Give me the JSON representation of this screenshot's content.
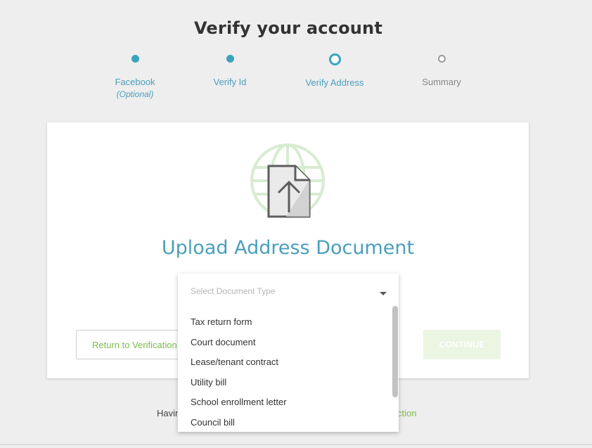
{
  "page": {
    "title": "Verify your account"
  },
  "steps": [
    {
      "label": "Facebook",
      "sublabel": "(Optional)",
      "state": "done"
    },
    {
      "label": "Verify Id",
      "state": "done"
    },
    {
      "label": "Verify Address",
      "state": "current"
    },
    {
      "label": "Summary",
      "state": "future"
    }
  ],
  "card": {
    "heading": "Upload Address Document",
    "return_label": "Return to Verification",
    "continue_label": "CONTINUE"
  },
  "dropdown": {
    "placeholder": "Select Document Type",
    "options": [
      "Tax return form",
      "Court document",
      "Lease/tenant contract",
      "Utility bill",
      "School enrollment letter",
      "Council bill"
    ]
  },
  "footer": {
    "help_text": "Havin",
    "help_link": "ction"
  },
  "colors": {
    "accent_blue": "#3aa4bf",
    "accent_green": "#7dbb4a",
    "continue_disabled_bg": "#eaf5e2"
  }
}
